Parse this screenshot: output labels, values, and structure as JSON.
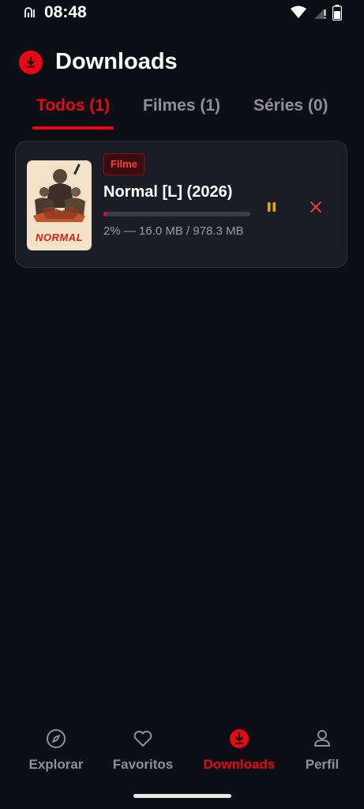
{
  "status_bar": {
    "time": "08:48",
    "icons": [
      "notification-icon",
      "wifi-icon",
      "signal-icon",
      "battery-icon"
    ]
  },
  "header": {
    "title": "Downloads",
    "icon": "download-icon"
  },
  "tabs": [
    {
      "label": "Todos (1)",
      "active": true
    },
    {
      "label": "Filmes (1)",
      "active": false
    },
    {
      "label": "Séries (0)",
      "active": false
    }
  ],
  "downloads": [
    {
      "badge": "Filme",
      "title": "Normal [L] (2026)",
      "poster_text": "NORMAL",
      "progress": 0.02,
      "meta": "2% — 16.0 MB / 978.3 MB"
    }
  ],
  "bottom_nav": [
    {
      "label": "Explorar",
      "icon": "compass-icon",
      "active": false
    },
    {
      "label": "Favoritos",
      "icon": "heart-icon",
      "active": false
    },
    {
      "label": "Downloads",
      "icon": "download-icon",
      "active": true
    },
    {
      "label": "Perfil",
      "icon": "profile-icon",
      "active": false
    }
  ],
  "colors": {
    "background": "#0d0f15",
    "accent": "#e50914",
    "card": "#1a1d25",
    "pause": "#f0a500",
    "muted": "#8d9097"
  }
}
